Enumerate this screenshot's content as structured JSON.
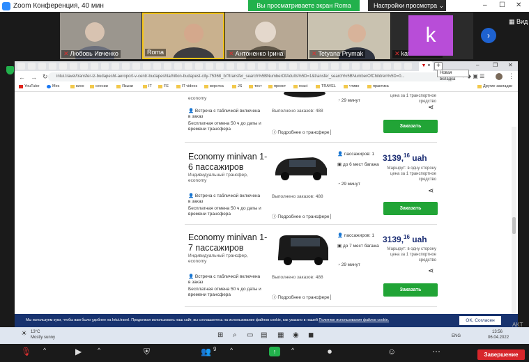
{
  "zoom": {
    "window_title": "Zoom Конференция, 40 мин",
    "share_banner": "Вы просматриваете экран Roma",
    "view_settings": "Настройки просмотра ⌄",
    "view_label": "Вид",
    "participants": [
      {
        "name": "Любовь Ивченко",
        "muted": true
      },
      {
        "name": "Roma",
        "muted": false
      },
      {
        "name": "Антоненко Ірина",
        "muted": true
      },
      {
        "name": "Tetyana Prymak",
        "muted": true
      },
      {
        "name": "katerina veres",
        "muted": true
      }
    ],
    "avatar_letter": "k",
    "end_label": "Завершение",
    "participants_count": "9"
  },
  "browser": {
    "url": "intui.travel/transfer-iz-budapesht-aeroport-v-centr-budapeshta/hilton-budapest-city-75368_b/?transfer_search%5BNumberOfAdults%5D=1&transfer_search%5BNumberOfChildren%5D=0...",
    "tooltip": "Новая вкладка",
    "tab_close": "×",
    "bookmarks": [
      "YouTube",
      "Mes",
      "кино",
      "сеесии",
      "Языки",
      "IT",
      "FE",
      "IT videos",
      "верстка",
      "JS",
      "тест",
      "проект",
      "react",
      "TRAVEL",
      "чтиво",
      "практика"
    ],
    "other_bookmarks": "Другие закладки"
  },
  "listings": [
    {
      "id": "card0",
      "title": "",
      "subtitle": "",
      "feature1": "Встреча с табличкой включена в заказ",
      "feature2": "Бесплатная отмена 50 ч до даты и времени трансфера",
      "orders": "Выполнено заказов: 488",
      "details": "Подробнее о трансфере",
      "passengers": "",
      "luggage": "",
      "duration": "29 минут",
      "price_int": "",
      "price_dec": "",
      "currency": "",
      "route": "цена за 1 транспортное средство",
      "order": "Заказать",
      "top_fragment": "economy"
    },
    {
      "id": "card1",
      "title": "Economy minivan 1-6 пассажиров",
      "subtitle": "Индивидуальный трансфер, economy",
      "feature1": "Встреча с табличкой включена в заказ",
      "feature2": "Бесплатная отмена 50 ч до даты и времени трансфера",
      "orders": "Выполнено заказов: 488",
      "details": "Подробнее о трансфере",
      "passengers": "пассажиров: 1",
      "luggage": "до 6 мест багажа",
      "duration": "29 минут",
      "price_int": "3139,",
      "price_dec": "16",
      "currency": "uah",
      "route": "Маршрут: в одну сторону цена за 1 транспортное средство",
      "order": "Заказать"
    },
    {
      "id": "card2",
      "title": "Economy minivan 1-7 пассажиров",
      "subtitle": "Индивидуальный трансфер, economy",
      "feature1": "Встреча с табличкой включена в заказ",
      "feature2": "Бесплатная отмена 50 ч до даты и времени трансфера",
      "orders": "Выполнено заказов: 488",
      "details": "Подробнее о трансфере",
      "passengers": "пассажиров: 1",
      "luggage": "до 7 мест багажа",
      "duration": "29 минут",
      "price_int": "3139,",
      "price_dec": "16",
      "currency": "uah",
      "route": "Маршрут: в одну сторону цена за 1 транспортное средство",
      "order": "Заказать"
    }
  ],
  "cookie": {
    "text": "Мы используем куки, чтобы вам было удобнее на Intui.travel. Продолжая использовать наш сайт, вы соглашаетесь на использование файлов cookie, как указано в нашей",
    "link": "Политике использования файлов cookie.",
    "ok": "OK, Согласен"
  },
  "taskbar": {
    "weather_temp": "13°C",
    "weather_text": "Mostly sunny",
    "lang": "ENG",
    "time": "13:56",
    "date": "06.04.2022"
  },
  "side_clip": "AKT\nобе\nразд"
}
